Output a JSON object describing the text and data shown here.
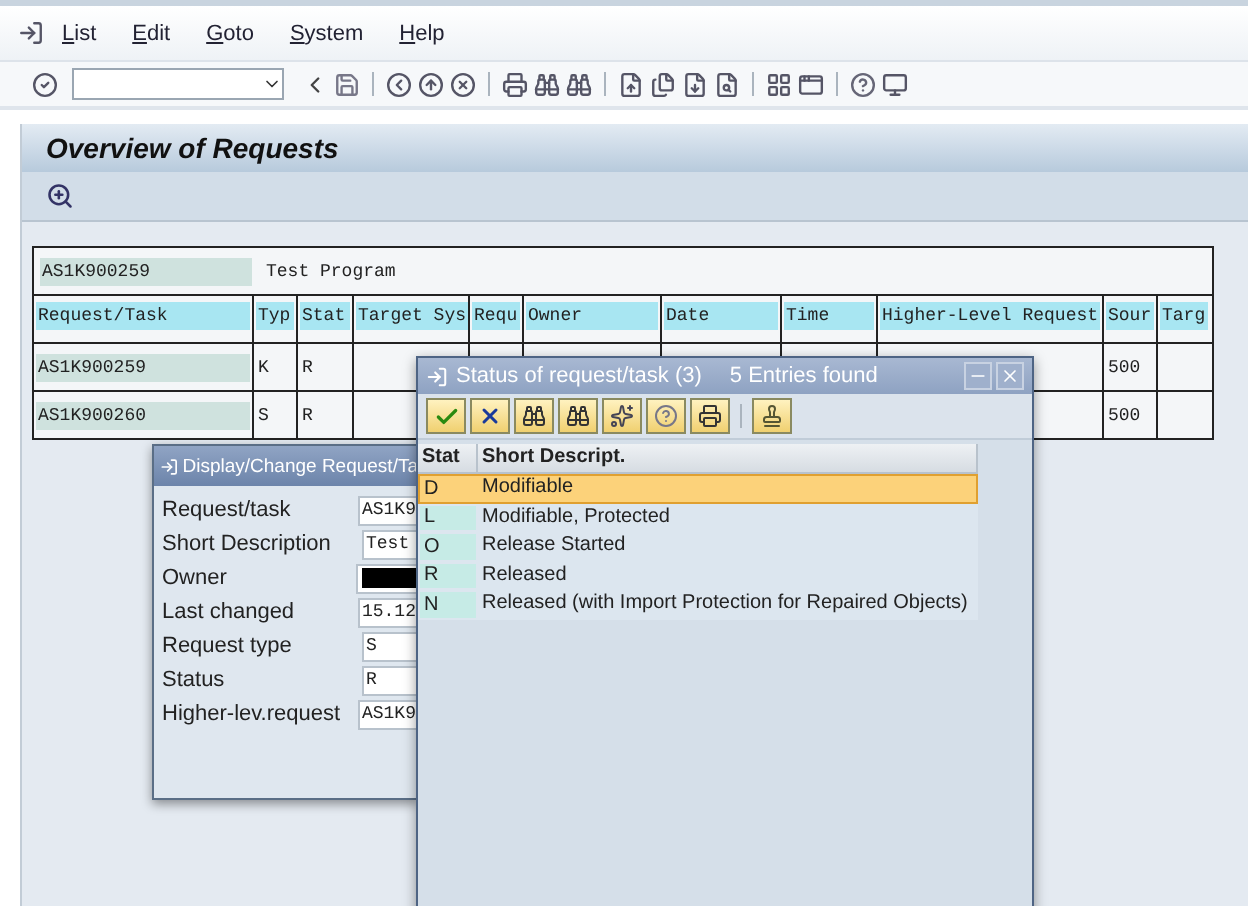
{
  "menu": [
    {
      "label": "List"
    },
    {
      "label": "Edit"
    },
    {
      "label": "Goto"
    },
    {
      "label": "System"
    },
    {
      "label": "Help"
    }
  ],
  "title": "Overview of Requests",
  "request_header": {
    "id": "AS1K900259",
    "description": "Test Program"
  },
  "table": {
    "columns": [
      "Request/Task",
      "Typ",
      "Stat",
      "Target Sys",
      "Requ",
      "Owner",
      "Date",
      "Time",
      "Higher-Level Request",
      "Sour",
      "Targ"
    ],
    "rows": [
      {
        "cells": [
          "AS1K900259",
          "K",
          "R",
          null,
          null,
          null,
          null,
          null,
          null,
          "500",
          null
        ]
      },
      {
        "cells": [
          "AS1K900260",
          "S",
          "R",
          null,
          null,
          null,
          null,
          null,
          null,
          "500",
          null
        ]
      }
    ]
  },
  "request_dialog": {
    "title": "Display/Change Request/Ta",
    "fields": [
      {
        "label": "Request/task",
        "value": "AS1K9",
        "redacted": false
      },
      {
        "label": "Short Description",
        "value": "Test",
        "redacted": false
      },
      {
        "label": "Owner",
        "redacted": true
      },
      {
        "label": "Last changed",
        "value": "15.12",
        "redacted": false
      },
      {
        "label": "Request type",
        "value": "S",
        "redacted": false
      },
      {
        "label": "Status",
        "value": "R",
        "redacted": false
      },
      {
        "label": "Higher-lev.request",
        "value": "AS1K9",
        "redacted": false
      }
    ]
  },
  "status_dialog": {
    "title": "Status of request/task (3)",
    "info": "5 Entries found",
    "columns": [
      "Stat",
      "Short Descript."
    ],
    "rows": [
      {
        "code": "D",
        "text": "Modifiable",
        "selected": true
      },
      {
        "code": "L",
        "text": "Modifiable, Protected",
        "selected": false
      },
      {
        "code": "O",
        "text": "Release Started",
        "selected": false
      },
      {
        "code": "R",
        "text": "Released",
        "selected": false
      },
      {
        "code": "N",
        "text": "Released (with Import Protection for Repaired Objects)",
        "selected": false
      }
    ]
  }
}
